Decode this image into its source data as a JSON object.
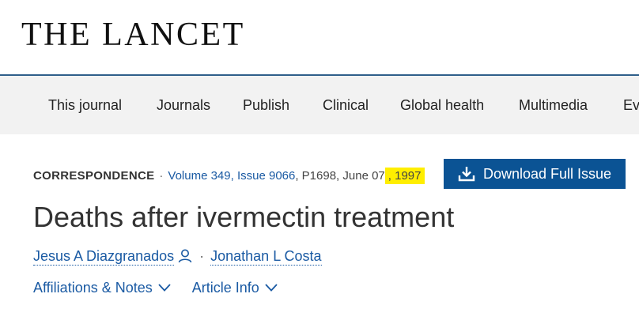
{
  "header": {
    "logo": "THE LANCET"
  },
  "nav": {
    "items": [
      {
        "label": "This journal"
      },
      {
        "label": "Journals"
      },
      {
        "label": "Publish"
      },
      {
        "label": "Clinical"
      },
      {
        "label": "Global health"
      },
      {
        "label": "Multimedia"
      },
      {
        "label": "Ev"
      }
    ]
  },
  "article": {
    "type": "CORRESPONDENCE",
    "separator": "·",
    "volume_issue": "Volume 349, Issue 9066",
    "page_date": ", P1698, June 07",
    "comma": ",",
    "year": "1997",
    "title": "Deaths after ivermectin treatment",
    "authors": [
      {
        "name": "Jesus A Diazgranados"
      },
      {
        "name": "Jonathan L Costa"
      }
    ],
    "author_separator": "·",
    "links": {
      "affiliations": "Affiliations & Notes",
      "article_info": "Article Info"
    }
  },
  "download_button": {
    "label": "Download Full Issue",
    "color": "#0b5394"
  },
  "highlight_color": "#ffee00",
  "icons": {
    "download": "download-icon",
    "person": "person-icon",
    "chevron": "chevron-down-icon"
  }
}
